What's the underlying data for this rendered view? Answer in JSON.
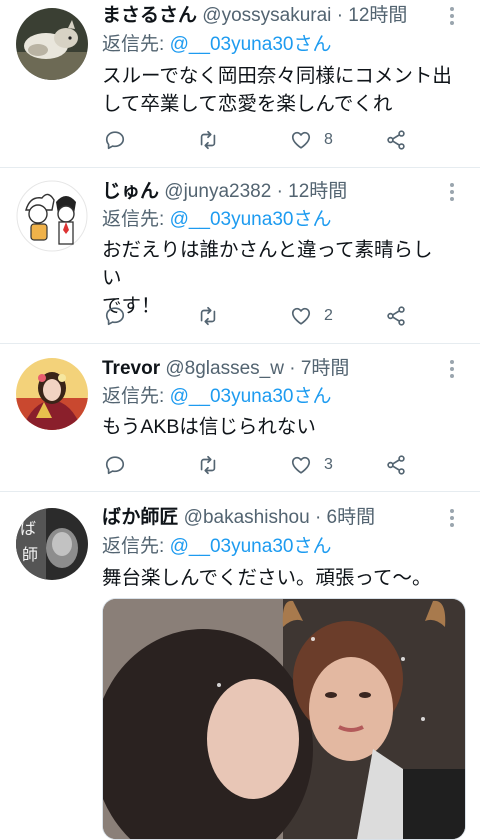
{
  "tweets": [
    {
      "name": "まさるさん",
      "handle": "@yossysakurai",
      "separator": "·",
      "time": "12時間",
      "reply_prefix": "返信先: ",
      "reply_to": "@__03yuna30さん",
      "text_lines": [
        "スルーでなく岡田奈々同様にコメント出",
        "して卒業して恋愛を楽しんでくれ"
      ],
      "likes": "8",
      "avatar": "cat-photo-avatar"
    },
    {
      "name": "じゅん",
      "handle": "@junya2382",
      "separator": "·",
      "time": "12時間",
      "reply_prefix": "返信先: ",
      "reply_to": "@__03yuna30さん",
      "text_lines": [
        "おだえりは誰かさんと違って素晴らしい",
        "です！"
      ],
      "likes": "2",
      "avatar": "cartoon-illustration-avatar"
    },
    {
      "name": "Trevor",
      "handle": "@8glasses_w",
      "separator": "·",
      "time": "7時間",
      "reply_prefix": "返信先: ",
      "reply_to": "@__03yuna30さん",
      "text_lines": [
        "もうAKBは信じられない"
      ],
      "likes": "3",
      "avatar": "kimono-portrait-avatar"
    },
    {
      "name": "ばか師匠",
      "handle": "@bakashishou",
      "separator": "·",
      "time": "6時間",
      "reply_prefix": "返信先: ",
      "reply_to": "@__03yuna30さん",
      "text_lines": [
        "舞台楽しんでください。頑張って〜。"
      ],
      "avatar": "monochrome-photo-avatar",
      "media": "attached-photo-two-people"
    }
  ],
  "icons": {
    "reply": "reply-icon",
    "retweet": "retweet-icon",
    "like": "heart-icon",
    "share": "share-icon",
    "more": "more-vertical-icon"
  },
  "colors": {
    "text": "#0f1419",
    "secondary": "#536471",
    "mention": "#1d9bf0",
    "divider": "#e6ecf0"
  }
}
